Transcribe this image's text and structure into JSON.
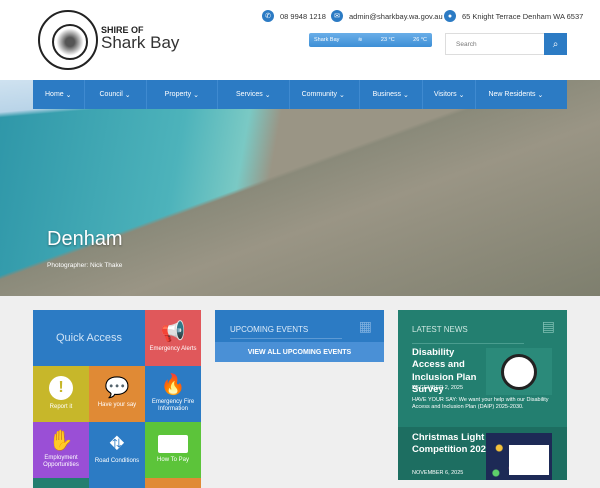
{
  "header": {
    "brand_small": "SHIRE OF",
    "brand_big": "Shark Bay",
    "phone": "08 9948 1218",
    "email": "admin@sharkbay.wa.gov.au",
    "address": "65 Knight Terrace Denham WA 6537",
    "weather": {
      "location": "Shark Bay",
      "temp_low": "23 °C",
      "temp_high": "26 °C"
    },
    "search_placeholder": "Search"
  },
  "nav": [
    "Home",
    "Council",
    "Property",
    "Services",
    "Community",
    "Business",
    "Visitors",
    "New Residents"
  ],
  "hero": {
    "title": "Denham",
    "credit": "Photographer: Nick Thake"
  },
  "quick_access": {
    "title": "Quick Access",
    "tiles": [
      {
        "label": "Emergency Alerts",
        "color": "#e0585b",
        "icon": "📢"
      },
      {
        "label": "Report it",
        "color": "#c7b72a",
        "icon": "!"
      },
      {
        "label": "Have your say",
        "color": "#e08a35",
        "icon": "💬"
      },
      {
        "label": "Emergency Fire Information",
        "color": "#2c7bc4",
        "icon": "🔥"
      },
      {
        "label": "Employment Opportunities",
        "color": "#9a4fd6",
        "icon": "✋"
      },
      {
        "label": "Road Conditions",
        "color": "#2c7bc4",
        "icon": "⛖"
      },
      {
        "label": "How To Pay",
        "color": "#5cc43a",
        "icon": "▭"
      }
    ]
  },
  "events": {
    "title": "UPCOMING EVENTS",
    "button": "VIEW ALL UPCOMING EVENTS"
  },
  "news": {
    "title": "LATEST NEWS",
    "items": [
      {
        "title": "Disability Access and Inclusion Plan Survey",
        "date": "DECEMBER 2, 2025",
        "excerpt": "HAVE YOUR SAY: We want your help with our Disability Access and Inclusion Plan (DAIP) 2025-2030."
      },
      {
        "title": "Christmas Light Competition 2025",
        "date": "NOVEMBER 6, 2025"
      }
    ]
  }
}
